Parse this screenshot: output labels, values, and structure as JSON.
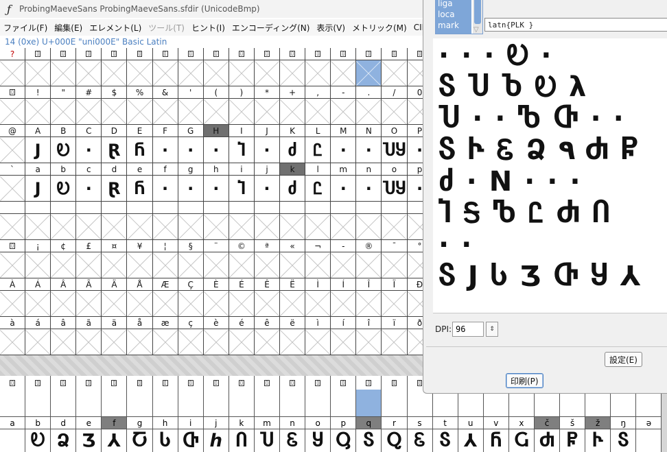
{
  "window": {
    "title": "ProbingMaeveSans  ProbingMaeveSans.sfdir (UnicodeBmp)",
    "icon": "fontforge-icon"
  },
  "menu": [
    {
      "label": "ファイル(F)",
      "disabled": false
    },
    {
      "label": "編集(E)",
      "disabled": false
    },
    {
      "label": "エレメント(L)",
      "disabled": false
    },
    {
      "label": "ツール(T)",
      "disabled": true
    },
    {
      "label": "ヒント(I)",
      "disabled": false
    },
    {
      "label": "エンコーディング(N)",
      "disabled": false
    },
    {
      "label": "表示(V)",
      "disabled": false
    },
    {
      "label": "メトリック(M)",
      "disabled": false
    },
    {
      "label": "CID(C)",
      "disabled": false
    },
    {
      "label": "MM",
      "disabled": false
    }
  ],
  "info_line": "14 (0xe) U+000E \"uni000E\" Basic Latin",
  "grid_rows": [
    {
      "labels": [
        "?",
        "▯",
        "▯",
        "▯",
        "▯",
        "▯",
        "▯",
        "▯",
        "▯",
        "▯",
        "▯",
        "▯",
        "▯",
        "▯",
        "▯",
        "▯",
        "▯"
      ],
      "label_box": true,
      "red": [
        0
      ],
      "sel_label": [],
      "glyphs": [
        "",
        "",
        "",
        "",
        "",
        "",
        "",
        "",
        "",
        "",
        "",
        "",
        "",
        "",
        "",
        "",
        ""
      ],
      "highlight": [
        14
      ]
    },
    {
      "labels": [
        "▯",
        "!",
        "\"",
        "#",
        "$",
        "%",
        "&",
        "'",
        "(",
        ")",
        "*",
        "+",
        ",",
        "-",
        ".",
        "/",
        "0"
      ],
      "label_box_first": true,
      "red": [],
      "sel_label": [],
      "glyphs": [
        "",
        "",
        "",
        "",
        "",
        "",
        "",
        "",
        "",
        "",
        "",
        "",
        "",
        "",
        "",
        "",
        ""
      ],
      "highlight": []
    },
    {
      "labels": [
        "@",
        "A",
        "B",
        "C",
        "D",
        "E",
        "F",
        "G",
        "H",
        "I",
        "J",
        "K",
        "L",
        "M",
        "N",
        "O",
        "P"
      ],
      "red": [],
      "sel_label": [
        8
      ],
      "glyphs": [
        "",
        "J",
        "Ꭷ",
        "·",
        "Ɽ",
        "Ⴌ",
        "·",
        "·",
        "·",
        "Ⴈ",
        "·",
        "ძ",
        "Ꮭ",
        "·",
        "·",
        "ႮႸ",
        "·"
      ],
      "highlight": []
    },
    {
      "labels": [
        "`",
        "a",
        "b",
        "c",
        "d",
        "e",
        "f",
        "g",
        "h",
        "i",
        "j",
        "k",
        "l",
        "m",
        "n",
        "o",
        "p"
      ],
      "red": [],
      "sel_label": [
        11
      ],
      "glyphs": [
        "",
        "J",
        "Ꭷ",
        "·",
        "Ɽ",
        "Ⴌ",
        "·",
        "·",
        "·",
        "Ⴈ",
        "·",
        "ძ",
        "Ꮭ",
        "·",
        "·",
        "ႮႸ",
        "·"
      ],
      "highlight": []
    },
    {
      "labels": [
        "",
        "",
        "",
        "",
        "",
        "",
        "",
        "",
        "",
        "",
        "",
        "",
        "",
        "",
        "",
        "",
        ""
      ],
      "red": [],
      "sel_label": [],
      "glyphs": [
        "",
        "",
        "",
        "",
        "",
        "",
        "",
        "",
        "",
        "",
        "",
        "",
        "",
        "",
        "",
        "",
        ""
      ],
      "highlight": []
    },
    {
      "labels": [
        "▯",
        "¡",
        "¢",
        "£",
        "¤",
        "¥",
        "¦",
        "§",
        "¨",
        "©",
        "ª",
        "«",
        "¬",
        "-",
        "®",
        "¯",
        "°"
      ],
      "label_box_first": true,
      "red": [],
      "sel_label": [],
      "glyphs": [
        "",
        "",
        "",
        "",
        "",
        "",
        "",
        "",
        "",
        "",
        "",
        "",
        "",
        "",
        "",
        "",
        ""
      ],
      "highlight": []
    },
    {
      "labels": [
        "À",
        "Á",
        "Â",
        "Ã",
        "Ä",
        "Å",
        "Æ",
        "Ç",
        "È",
        "É",
        "Ê",
        "Ë",
        "Ì",
        "Í",
        "Î",
        "Ï",
        "Ð"
      ],
      "red": [],
      "sel_label": [],
      "glyphs": [
        "",
        "",
        "",
        "",
        "",
        "",
        "",
        "",
        "",
        "",
        "",
        "",
        "",
        "",
        "",
        "",
        ""
      ],
      "highlight": []
    },
    {
      "labels": [
        "à",
        "á",
        "â",
        "ã",
        "ä",
        "å",
        "æ",
        "ç",
        "è",
        "é",
        "ê",
        "ë",
        "ì",
        "í",
        "î",
        "ï",
        "ð"
      ],
      "red": [],
      "sel_label": [],
      "glyphs": [
        "",
        "",
        "",
        "",
        "",
        "",
        "",
        "",
        "",
        "",
        "",
        "",
        "",
        "",
        "",
        "",
        ""
      ],
      "highlight": []
    }
  ],
  "bg_window": {
    "top_labels": [
      "▯",
      "▯",
      "▯",
      "▯",
      "▯",
      "▯",
      "▯",
      "▯",
      "▯",
      "▯",
      "▯",
      "▯",
      "▯",
      "▯",
      "▯",
      "▯",
      "▯",
      "▯",
      "▯",
      "▯",
      "▯",
      "▯",
      "▯",
      "▯",
      "▯",
      "▯"
    ],
    "highlight": [
      14
    ],
    "labels": [
      "a",
      "b",
      "d",
      "e",
      "f",
      "g",
      "h",
      "i",
      "j",
      "k",
      "m",
      "n",
      "o",
      "p",
      "q",
      "r",
      "s",
      "t",
      "u",
      "v",
      "x",
      "č",
      "š",
      "ž",
      "ŋ",
      "ə"
    ],
    "selected": [
      4,
      14,
      21,
      23
    ],
    "glyphs": [
      "",
      "Ꭷ",
      "Ձ",
      "Ʒ",
      "⅄",
      "Ⴀ",
      "Ⴑ",
      "Ⴇ",
      "ℎ",
      "Ⴖ",
      "Ⴎ",
      "Ꮛ",
      "Ⴘ",
      "Ⴓ",
      "Ⴝ",
      "Ⴍ",
      "Ꮛ",
      "Ⴝ",
      "⅄",
      "Ⴌ",
      "Ⴚ",
      "Ⴛ",
      "Ⴜ",
      "Ⴡ",
      "Ⴝ",
      ""
    ]
  },
  "dialog": {
    "features": [
      "liga",
      "loca",
      "mark"
    ],
    "script_value": "latn{PLK }",
    "preview_lines": [
      "· · · Ꭷ ·",
      "Ⴝ Ⴎ Ⴆ Ꭷ λ",
      "Ⴎ · · Ⴊ Ⴇ · ·",
      "Ⴝ Ⴡ Ꮛ Ձ ٩ Ⴛ Ⴜ",
      "ძ · N · · ·",
      "Ⴈ Ꭶ Ⴊ Ꮭ Ⴛ Ⴖ",
      "·   ·",
      "Ⴝ J Ⴑ Ʒ Ⴇ Ⴘ ⅄"
    ],
    "dpi_label": "DPI:",
    "dpi_value": "96",
    "spin_icon": "spin-updown-icon",
    "setup_label": "設定(E)",
    "print_label": "印刷(P)"
  },
  "colors": {
    "highlight": "#8fb2df",
    "selected": "#707070",
    "accent": "#4a7fc0",
    "red": "#c00000"
  }
}
